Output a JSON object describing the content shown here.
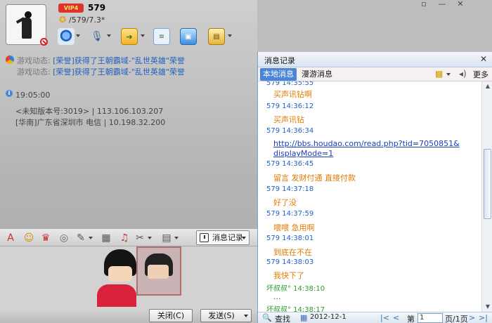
{
  "window_controls": {
    "menu": "▫",
    "minimize": "—",
    "close": "✕"
  },
  "profile": {
    "vip_badge": "VIP4",
    "nickname": "579",
    "signature": "/579/7.3*"
  },
  "toolbar_icons": [
    "video-call-icon",
    "voice-call-icon",
    "transfer-file-icon",
    "send-sms-icon",
    "remote-assist-icon",
    "app-menu-icon"
  ],
  "game_feed": {
    "label": "游戏动态:",
    "items": [
      "[荣誉]获得了王朝霸域-\"乱世英雄\"荣誉",
      "[荣誉]获得了王朝霸域-\"乱世英雄\"荣誉"
    ]
  },
  "info": {
    "time": "19:05:00",
    "line1": "<未知版本号:3019> | 113.106.103.207",
    "line2": "[华南]广东省深圳市 电信 | 10.198.32.200"
  },
  "format_bar": {
    "history_button": "消息记录"
  },
  "buttons": {
    "close": "关闭(C)",
    "send": "发送(S)"
  },
  "history": {
    "title": "消息记录",
    "tabs": [
      "本地消息",
      "漫游消息"
    ],
    "more": "更多",
    "messages": [
      {
        "head": "579  14:35:55",
        "color": "blue",
        "body": "买声讯钻啊"
      },
      {
        "head": "579  14:36:12",
        "color": "blue",
        "body": "买声讯钻"
      },
      {
        "head": "579  14:36:34",
        "color": "blue",
        "link": "http://bbs.houdao.com/read.php?tid=7050851&displayMode=1"
      },
      {
        "head": "579  14:36:45",
        "color": "blue",
        "body": "留言 发财付通 直接付款"
      },
      {
        "head": "579  14:37:18",
        "color": "blue",
        "body": "好了没"
      },
      {
        "head": "579  14:37:59",
        "color": "blue",
        "body": "喂喂 急用啊"
      },
      {
        "head": "579  14:38:01",
        "color": "blue",
        "body": "到底在不在"
      },
      {
        "head": "579  14:38:03",
        "color": "blue",
        "body": "我快下了"
      },
      {
        "head": "坏叔叔°  14:38:10",
        "color": "green",
        "body": "..."
      },
      {
        "head": "坏叔叔°  14:38:17",
        "color": "green",
        "body": ""
      }
    ],
    "footer": {
      "search": "查找",
      "date": "2012-12-1",
      "page_label": "第",
      "page_value": "1",
      "page_total": "页/1页"
    }
  }
}
